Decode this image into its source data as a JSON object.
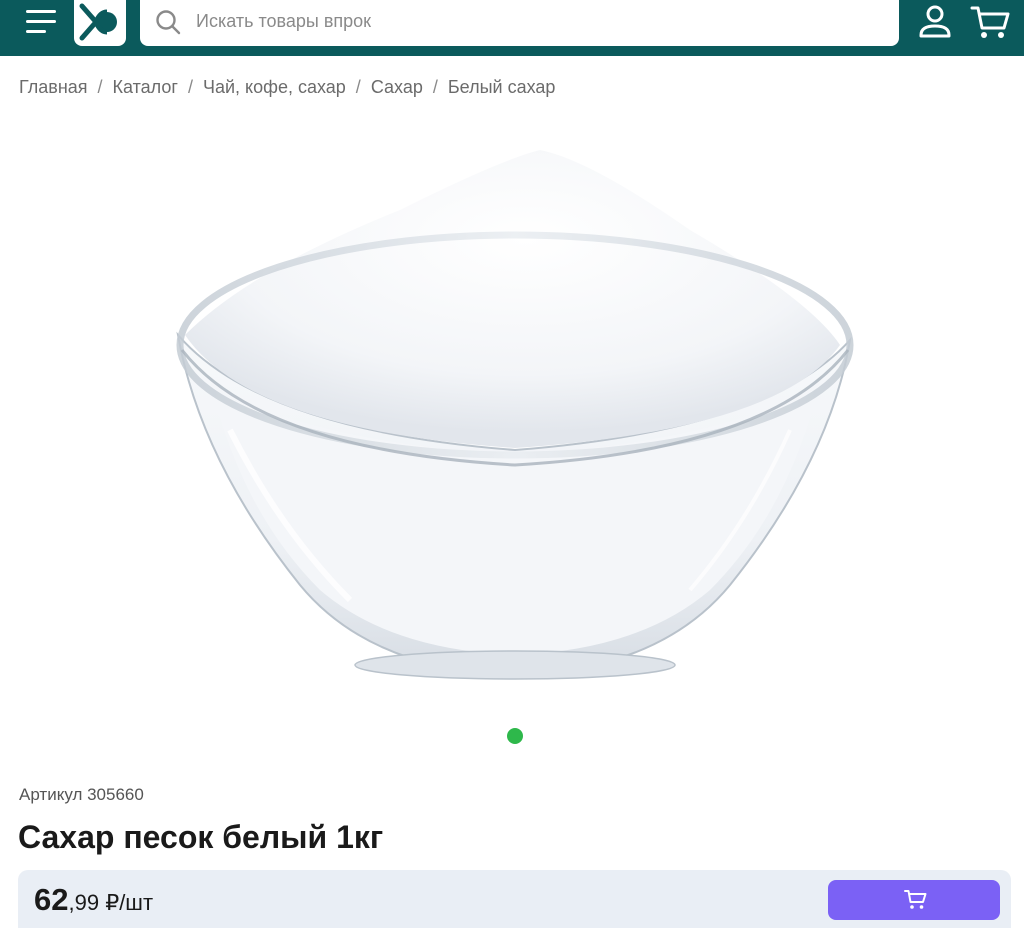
{
  "header": {
    "search_placeholder": "Искать товары впрок"
  },
  "breadcrumb": {
    "items": [
      "Главная",
      "Каталог",
      "Чай, кофе, сахар",
      "Сахар",
      "Белый сахар"
    ],
    "separator": "/"
  },
  "product": {
    "sku": "Артикул 305660",
    "title": "Сахар песок белый 1кг",
    "price_int": "62",
    "price_frac": ",99",
    "price_unit": " ₽/шт",
    "gallery_active_index": 1,
    "gallery_count": 1
  },
  "colors": {
    "header_bg": "#0b5a5c",
    "accent_button": "#7b61f5",
    "gallery_dot": "#2eb84b",
    "price_bar_bg": "#e9eef5"
  },
  "icons": {
    "menu": "menu-icon",
    "logo": "brand-logo",
    "search": "search-icon",
    "profile": "user-icon",
    "cart": "cart-icon"
  }
}
